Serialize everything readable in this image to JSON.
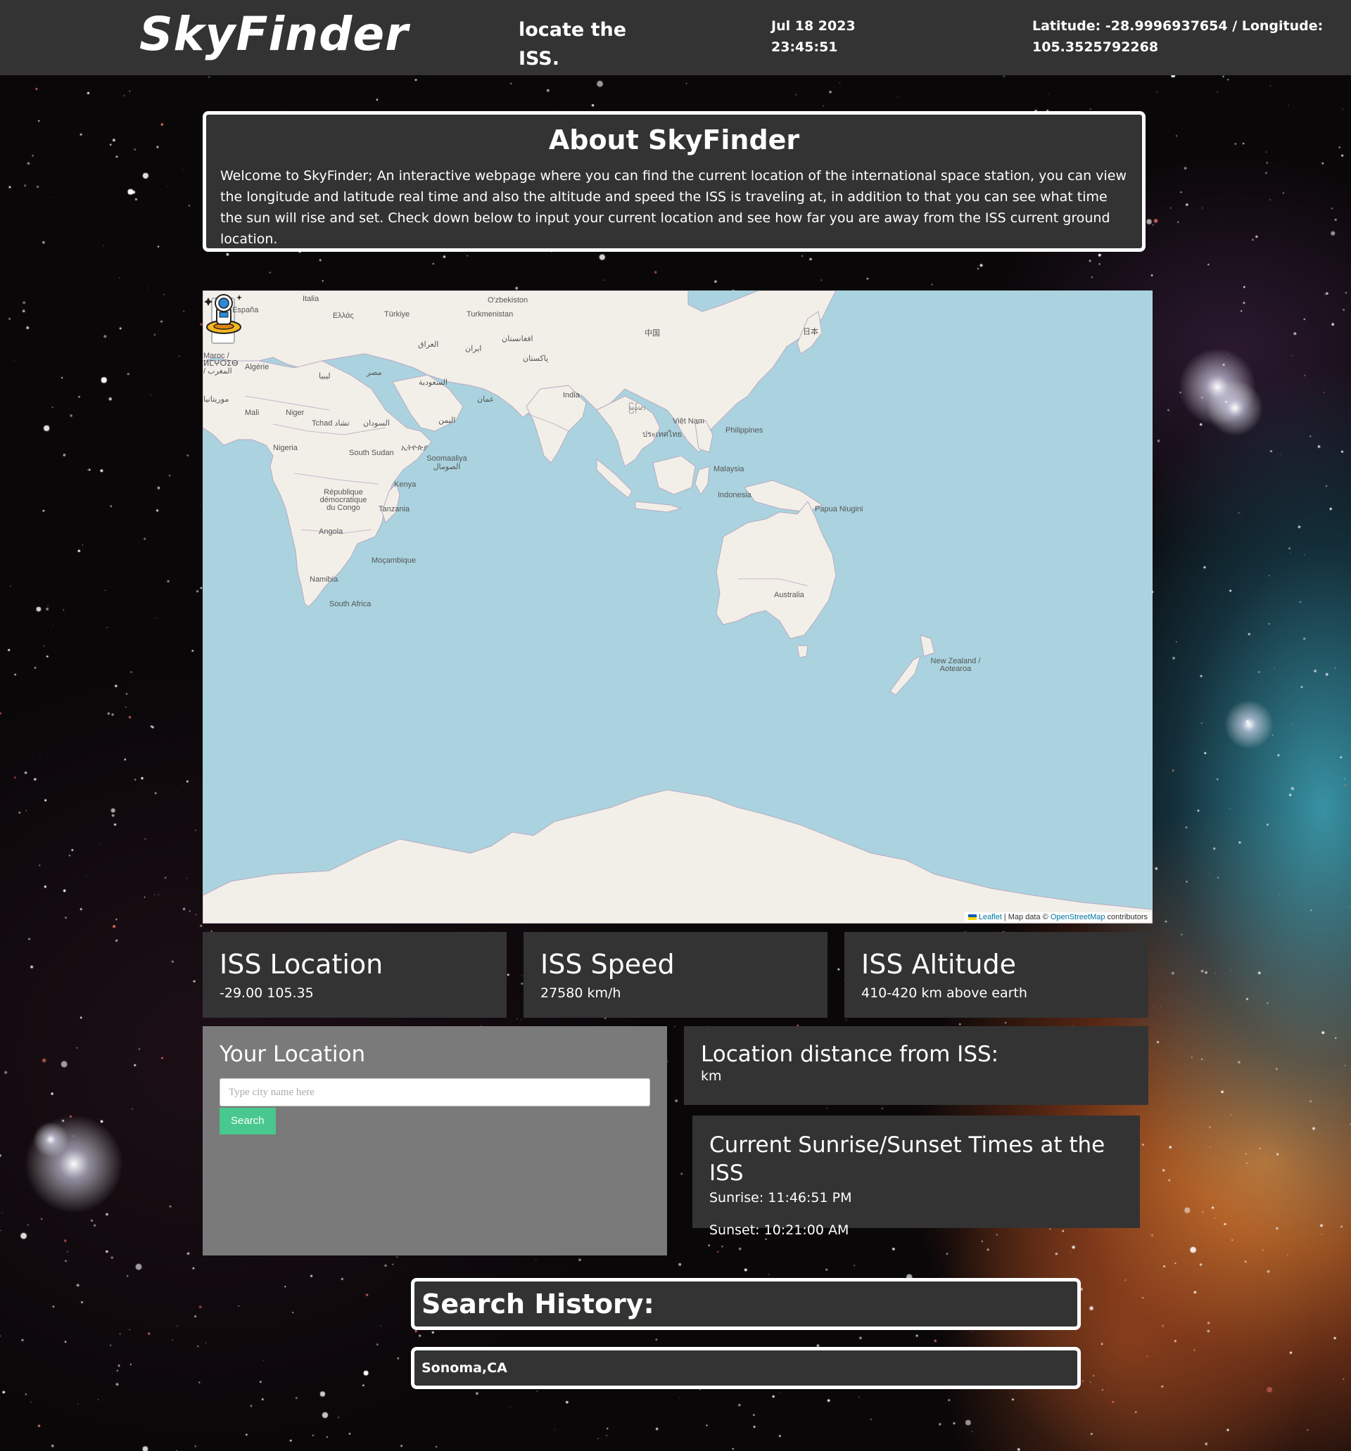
{
  "header": {
    "logo": "SkyFinder",
    "tagline": "locate the ISS.",
    "date": "Jul 18 2023",
    "time": "23:45:51",
    "coordinates": "Latitude: -28.9996937654 / Longitude: 105.3525792268"
  },
  "about": {
    "title": "About SkyFinder",
    "text": "Welcome to SkyFinder; An interactive webpage where you can find the current location of the international space station, you can view the longitude and latitude real time and also the altitude and speed the ISS is traveling at, in addition to that you can see what time the sun will rise and set. Check down below to input your current location and see how far you are away from the ISS current ground location."
  },
  "map": {
    "zoom_in": "+",
    "zoom_out": "−",
    "attribution_leaflet": "Leaflet",
    "attribution_mid": " | Map data © ",
    "attribution_osm": "OpenStreetMap",
    "attribution_end": " contributors",
    "labels": [
      "Italia",
      "España",
      "Ελλάς",
      "Türkiye",
      "O'zbekiston",
      "Turkmenistan",
      "Algérie",
      "Maroc / ⵍⵎⵖⵔⵉⴱ / المغرب",
      "ليبيا",
      "مصر",
      "العراق",
      "ایران",
      "افغانستان",
      "پاکستان",
      "中国",
      "日本",
      "India",
      "السعودية",
      "عمان",
      "اليمن",
      "Mali",
      "Niger",
      "Tchad تشاد",
      "السودان",
      "موريتانيا",
      "Nigeria",
      "South Sudan",
      "ኢትዮጵያ",
      "Soomaaliya الصومال",
      "Kenya",
      "République démocratique du Congo",
      "Tanzania",
      "Angola",
      "Moçambique",
      "Namibia",
      "South Africa",
      "မြန်မာ",
      "ประเทศไทย",
      "Việt Nam",
      "Philippines",
      "Malaysia",
      "Indonesia",
      "Papua Niugini",
      "Australia",
      "New Zealand / Aotearoa"
    ]
  },
  "stats": {
    "location_title": "ISS Location",
    "location_value": "-29.00 105.35",
    "speed_title": "ISS Speed",
    "speed_value": "27580 km/h",
    "altitude_title": "ISS Altitude",
    "altitude_value": "410-420 km above earth"
  },
  "your_location": {
    "title": "Your Location",
    "placeholder": "Type city name here",
    "value": "",
    "search_label": "Search"
  },
  "distance": {
    "title": "Location distance from ISS:",
    "value": "km"
  },
  "sun": {
    "title": "Current Sunrise/Sunset Times at the ISS",
    "sunrise": "Sunrise: 11:46:51 PM",
    "sunset": "Sunset: 10:21:00 AM"
  },
  "history": {
    "title": "Search History:",
    "items": [
      "Sonoma,CA"
    ]
  },
  "colors": {
    "header_bg": "#333333",
    "card_bg": "#333333",
    "your_location_bg": "#7a7a7a",
    "search_button": "#48c78e",
    "map_water": "#aad3df",
    "map_land": "#f2efe9"
  },
  "icons": [
    "astronaut-icon",
    "leaflet-flag-icon"
  ]
}
